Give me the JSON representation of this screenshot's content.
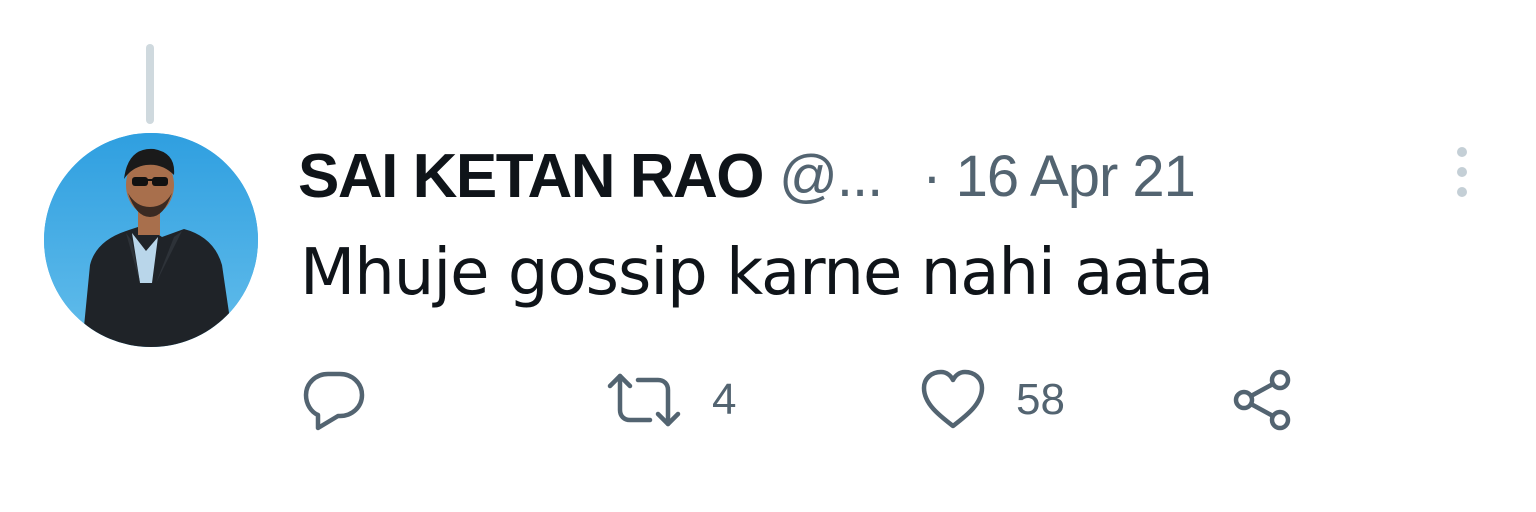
{
  "tweet": {
    "display_name": "SAI KETAN RAO",
    "handle": "@...",
    "separator": "·",
    "date": "16 Apr 21",
    "text": "Mhuje gossip karne nahi aata"
  },
  "actions": {
    "reply": {
      "icon": "reply-icon",
      "count": ""
    },
    "retweet": {
      "icon": "retweet-icon",
      "count": "4"
    },
    "like": {
      "icon": "heart-icon",
      "count": "58"
    },
    "share": {
      "icon": "share-icon"
    }
  },
  "colors": {
    "text_primary": "#0f1419",
    "text_secondary": "#536471",
    "thread_line": "#cfd9de",
    "avatar_sky": "#3aa6df"
  }
}
